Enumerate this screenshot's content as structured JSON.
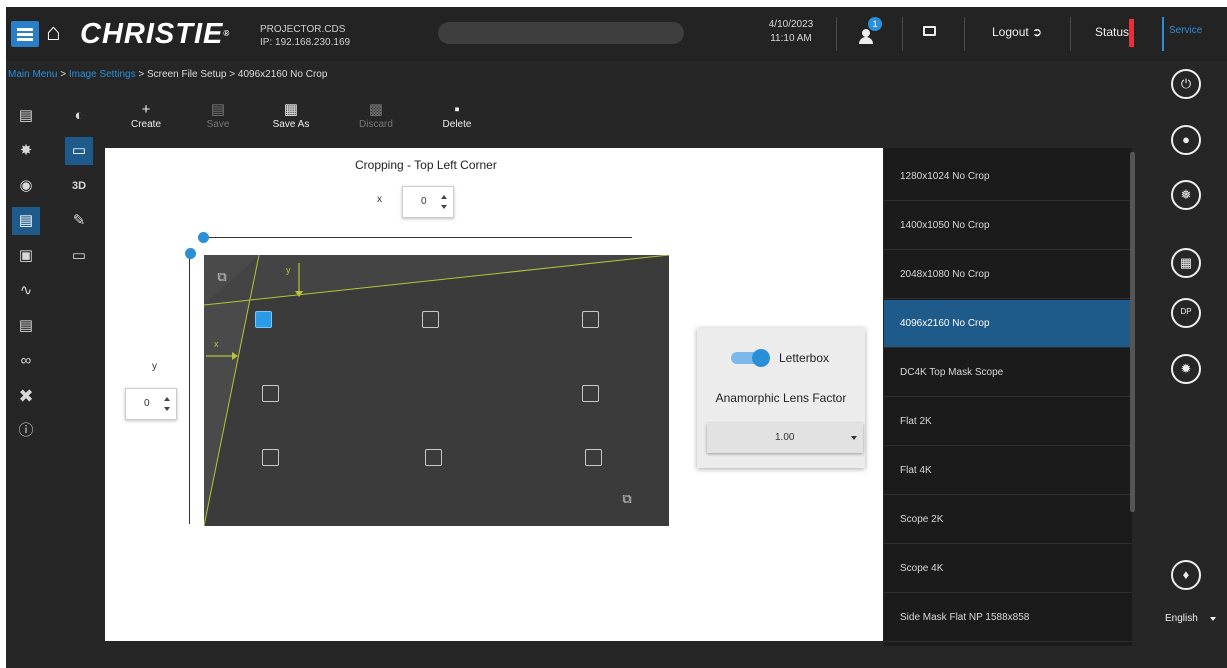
{
  "header": {
    "logo": "CHRISTIE",
    "projector_name": "PROJECTOR.CDS",
    "projector_ip": "IP: 192.168.230.169",
    "date": "4/10/2023",
    "time": "11:10 AM",
    "notification_count": "1",
    "logout_label": "Logout",
    "status_label": "Status",
    "service_label": "Service",
    "status_color": "#e8303a",
    "accent_color": "#2a8fd9"
  },
  "breadcrumb": {
    "main_menu": "Main Menu",
    "sep": " > ",
    "image_settings": "Image Settings",
    "screen_file_setup": "Screen File Setup",
    "current": "4096x2160 No Crop"
  },
  "toolbar": {
    "create": "Create",
    "save": "Save",
    "save_as": "Save As",
    "discard": "Discard",
    "delete": "Delete"
  },
  "cropping": {
    "title": "Cropping - Top Left Corner",
    "x_label": "x",
    "x_value": "0",
    "y_label": "y",
    "y_value": "0",
    "x_arrow": "x",
    "y_arrow": "y"
  },
  "letterbox": {
    "label": "Letterbox",
    "enabled": true,
    "lens_factor_label": "Anamorphic Lens Factor",
    "lens_factor_value": "1.00"
  },
  "files": [
    "1280x1024 No Crop",
    "1400x1050 No Crop",
    "2048x1080 No Crop",
    "4096x2160 No Crop",
    "DC4K Top Mask Scope",
    "Flat 2K",
    "Flat 4K",
    "Scope 2K",
    "Scope 4K",
    "Side Mask Flat NP 1588x858"
  ],
  "selected_file": "4096x2160 No Crop",
  "language": "English",
  "right_rail_icons": [
    "power-icon",
    "lamp-icon",
    "shutter-icon",
    "test-pattern-icon",
    "dp-icon",
    "quick-function-icon",
    "notification-bell-icon"
  ],
  "right_rail_labels": {
    "dp": "DP"
  }
}
